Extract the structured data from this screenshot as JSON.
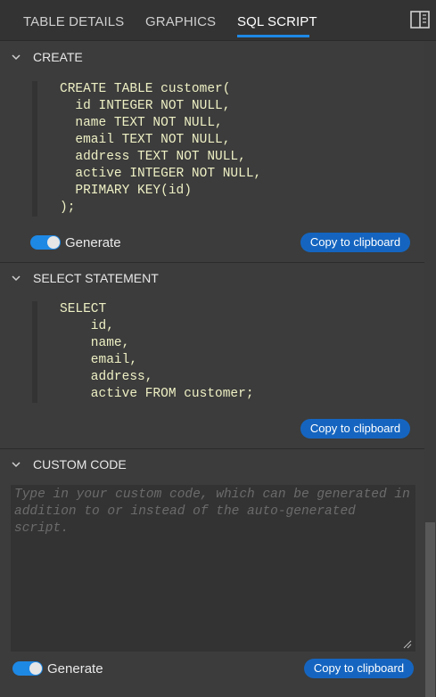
{
  "tabs": [
    {
      "label": "TABLE DETAILS",
      "active": false
    },
    {
      "label": "GRAPHICS",
      "active": false
    },
    {
      "label": "SQL SCRIPT",
      "active": true
    }
  ],
  "icons": {
    "panel_toggle": "split-panel-icon",
    "chevron": "chevron-down-icon",
    "resize": "resize-grip-icon"
  },
  "colors": {
    "accent": "#1e88e5",
    "button": "#1565c0",
    "code_text": "#eef0c4",
    "background": "#3c3c3c"
  },
  "create": {
    "title": "CREATE",
    "code_lines": [
      "CREATE TABLE customer(",
      "  id INTEGER NOT NULL,",
      "  name TEXT NOT NULL,",
      "  email TEXT NOT NULL,",
      "  address TEXT NOT NULL,",
      "  active INTEGER NOT NULL,",
      "  PRIMARY KEY(id)",
      ");"
    ],
    "generate_label": "Generate",
    "generate_on": true,
    "copy_label": "Copy to clipboard"
  },
  "select": {
    "title": "SELECT STATEMENT",
    "code_lines": [
      "SELECT",
      "    id,",
      "    name,",
      "    email,",
      "    address,",
      "    active FROM customer;"
    ],
    "copy_label": "Copy to clipboard"
  },
  "custom": {
    "title": "CUSTOM CODE",
    "value": "",
    "placeholder": "Type in your custom code, which can be generated in addition to or instead of the auto-generated script.",
    "generate_label": "Generate",
    "generate_on": true,
    "copy_label": "Copy to clipboard"
  }
}
